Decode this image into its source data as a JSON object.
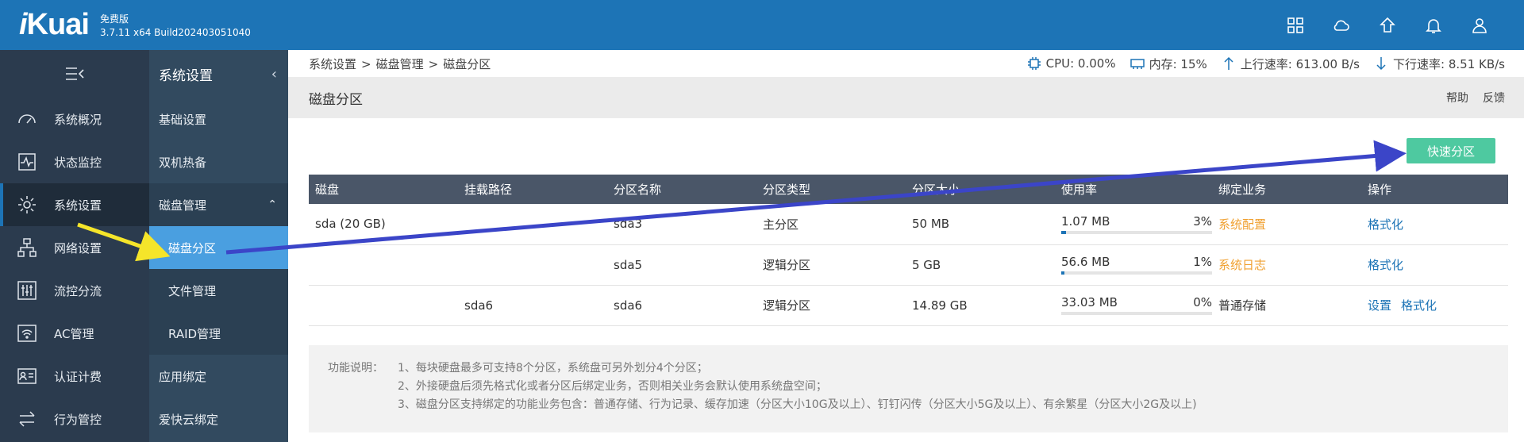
{
  "header": {
    "logo_i": "i",
    "logo_rest": "Kuai",
    "edition": "免费版",
    "version": "3.7.11 x64 Build202403051040",
    "icons": [
      "apps-icon",
      "cloud-icon",
      "home-icon",
      "bell-icon",
      "user-icon"
    ]
  },
  "nav_primary": [
    {
      "label": "系统概况",
      "icon": "dashboard-icon"
    },
    {
      "label": "状态监控",
      "icon": "monitor-icon"
    },
    {
      "label": "系统设置",
      "icon": "gear-icon"
    },
    {
      "label": "网络设置",
      "icon": "network-icon"
    },
    {
      "label": "流控分流",
      "icon": "sliders-icon"
    },
    {
      "label": "AC管理",
      "icon": "wifi-icon"
    },
    {
      "label": "认证计费",
      "icon": "id-card-icon"
    },
    {
      "label": "行为管控",
      "icon": "swap-icon"
    }
  ],
  "nav_secondary": {
    "title": "系统设置",
    "items": [
      "基础设置",
      "双机热备",
      "磁盘管理"
    ],
    "subitems": [
      "磁盘分区",
      "文件管理",
      "RAID管理"
    ],
    "after": [
      "应用绑定",
      "爱快云绑定"
    ]
  },
  "breadcrumb": [
    "系统设置",
    "磁盘管理",
    "磁盘分区"
  ],
  "breadcrumb_sep": ">",
  "stats": {
    "cpu": "CPU: 0.00%",
    "mem": "内存: 15%",
    "up": "上行速率: 613.00 B/s",
    "down": "下行速率: 8.51 KB/s"
  },
  "page": {
    "title": "磁盘分区",
    "help": "帮助",
    "feedback": "反馈",
    "quick_button": "快速分区"
  },
  "table": {
    "headers": [
      "磁盘",
      "挂载路径",
      "分区名称",
      "分区类型",
      "分区大小",
      "使用率",
      "绑定业务",
      "操作"
    ],
    "rows": [
      {
        "disk": "sda (20 GB)",
        "mount": "",
        "name": "sda3",
        "type": "主分区",
        "size": "50 MB",
        "used": "1.07 MB",
        "pct": "3%",
        "pct_value": 0.03,
        "service": "系统配置",
        "service_color": "orange",
        "ops": [
          "格式化"
        ]
      },
      {
        "disk": "",
        "mount": "",
        "name": "sda5",
        "type": "逻辑分区",
        "size": "5 GB",
        "used": "56.6 MB",
        "pct": "1%",
        "pct_value": 0.01,
        "service": "系统日志",
        "service_color": "orange",
        "ops": [
          "格式化"
        ]
      },
      {
        "disk": "",
        "mount": "sda6",
        "name": "sda6",
        "type": "逻辑分区",
        "size": "14.89 GB",
        "used": "33.03 MB",
        "pct": "0%",
        "pct_value": 0.0,
        "service": "普通存储",
        "service_color": "default",
        "ops": [
          "设置",
          "格式化"
        ]
      }
    ]
  },
  "notes": {
    "label": "功能说明：",
    "lines": [
      "1、每块硬盘最多可支持8个分区，系统盘可另外划分4个分区；",
      "2、外接硬盘后须先格式化或者分区后绑定业务，否则相关业务会默认使用系统盘空间；",
      "3、磁盘分区支持绑定的功能业务包含：普通存储、行为记录、缓存加速（分区大小10G及以上）、钉钉闪传（分区大小5G及以上）、有余繁星（分区大小2G及以上)"
    ]
  },
  "colors": {
    "header": "#1d74b6",
    "nav_primary": "#2b3b4e",
    "nav_secondary": "#324a5f",
    "active_sub": "#4a9fe0",
    "quick_button": "#4ec9a0",
    "table_header": "#4a5668",
    "annotation_yellow": "#f5e52a",
    "annotation_blue": "#3b45c8"
  }
}
